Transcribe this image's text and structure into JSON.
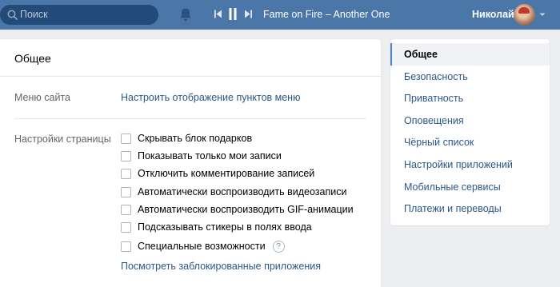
{
  "topbar": {
    "search_placeholder": "Поиск",
    "player": {
      "track": "Fame on Fire – Another One"
    },
    "user_name": "Николай"
  },
  "main": {
    "title": "Общее",
    "site_menu": {
      "label": "Меню сайта",
      "link": "Настроить отображение пунктов меню"
    },
    "page_settings": {
      "label": "Настройки страницы",
      "options": [
        {
          "label": "Скрывать блок подарков",
          "checked": false
        },
        {
          "label": "Показывать только мои записи",
          "checked": false
        },
        {
          "label": "Отключить комментирование записей",
          "checked": false
        },
        {
          "label": "Автоматически воспроизводить видеозаписи",
          "checked": false
        },
        {
          "label": "Автоматически воспроизводить GIF-анимации",
          "checked": false
        },
        {
          "label": "Подсказывать стикеры в полях ввода",
          "checked": false
        },
        {
          "label": "Специальные возможности",
          "checked": false
        }
      ],
      "help_glyph": "?",
      "blocked_apps_link": "Посмотреть заблокированные приложения"
    }
  },
  "sidebar": {
    "items": [
      {
        "label": "Общее",
        "active": true
      },
      {
        "label": "Безопасность"
      },
      {
        "label": "Приватность"
      },
      {
        "label": "Оповещения"
      },
      {
        "label": "Чёрный список"
      },
      {
        "label": "Настройки приложений"
      },
      {
        "label": "Мобильные сервисы"
      },
      {
        "label": "Платежи и переводы"
      }
    ]
  },
  "colors": {
    "header_bg": "#4a76a8",
    "search_bg": "#224b7a",
    "link": "#2a5885",
    "page_bg": "#edeef0",
    "active_marker": "#5181b8"
  },
  "icons": [
    "search-icon",
    "bell-icon",
    "previous-track-icon",
    "pause-icon",
    "next-track-icon",
    "chevron-down-icon",
    "help-icon"
  ]
}
